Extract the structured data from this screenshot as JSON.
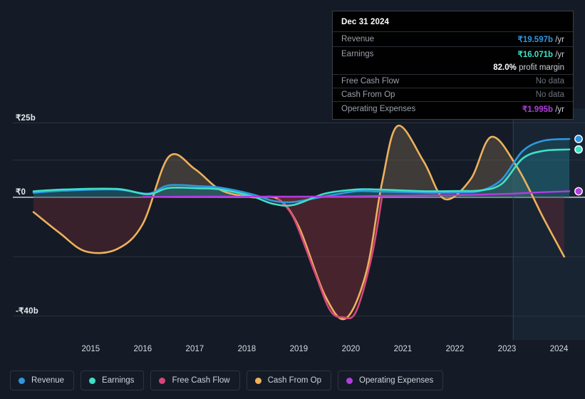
{
  "chart_data": {
    "type": "area",
    "title": "",
    "xlabel": "",
    "ylabel": "",
    "currency_symbol": "₹",
    "y_axis": {
      "ticks": [
        "₹25b",
        "₹0",
        "-₹40b"
      ],
      "tick_values": [
        25,
        0,
        -40
      ],
      "ylim": [
        -48,
        28
      ],
      "unit": "billions INR"
    },
    "x_axis": {
      "ticks": [
        "2015",
        "2016",
        "2017",
        "2018",
        "2019",
        "2020",
        "2021",
        "2022",
        "2023",
        "2024"
      ],
      "xlim": [
        2014.4,
        2025.0
      ]
    },
    "grid": true,
    "legend_position": "bottom",
    "series": [
      {
        "name": "Revenue",
        "color": "#2e97e0",
        "x": [
          2014.4,
          2015,
          2016,
          2016.6,
          2017,
          2017.6,
          2018,
          2018.6,
          2019,
          2019.4,
          2020,
          2020.6,
          2021,
          2021.6,
          2022,
          2022.6,
          2023,
          2023.4,
          2023.8,
          2024.2,
          2024.7
        ],
        "values": [
          1.5,
          2.2,
          2.6,
          1.2,
          4.0,
          3.7,
          3.2,
          1.0,
          -1.2,
          -1.6,
          0.3,
          2.0,
          1.9,
          1.7,
          1.5,
          1.6,
          2.2,
          6.0,
          15.5,
          19.0,
          19.597
        ]
      },
      {
        "name": "Earnings",
        "color": "#3fe0c8",
        "x": [
          2014.4,
          2015,
          2016,
          2016.6,
          2017,
          2017.6,
          2018,
          2018.6,
          2019,
          2019.4,
          2020,
          2020.6,
          2021,
          2021.6,
          2022,
          2022.6,
          2023,
          2023.4,
          2023.8,
          2024.2,
          2024.7
        ],
        "values": [
          2.0,
          2.6,
          2.8,
          1.0,
          3.1,
          3.0,
          2.6,
          0.3,
          -2.2,
          -2.6,
          1.2,
          2.6,
          2.6,
          2.2,
          2.0,
          2.1,
          2.3,
          4.5,
          13.0,
          15.6,
          16.071
        ]
      },
      {
        "name": "Free Cash Flow",
        "color": "#d4467a",
        "x": [
          2019.1,
          2019.4,
          2019.8,
          2020.1,
          2020.35,
          2020.6,
          2020.9,
          2021.1
        ],
        "values": [
          -0.5,
          -7.0,
          -25.0,
          -38.0,
          -40.4,
          -38.5,
          -20.0,
          0.2
        ]
      },
      {
        "name": "Cash From Op",
        "color": "#eeb15c",
        "x": [
          2014.4,
          2014.9,
          2015.4,
          2016.0,
          2016.5,
          2017.0,
          2017.5,
          2018.0,
          2018.6,
          2019.1,
          2019.5,
          2020.0,
          2020.4,
          2020.8,
          2021.1,
          2021.4,
          2021.9,
          2022.3,
          2022.8,
          2023.2,
          2023.7,
          2024.2,
          2024.6
        ],
        "values": [
          -5.0,
          -12.0,
          -18.2,
          -17.5,
          -9.0,
          13.6,
          9.5,
          2.4,
          0.0,
          -0.6,
          -10.0,
          -33.0,
          -40.8,
          -25.0,
          5.0,
          24.0,
          12.0,
          -0.6,
          6.0,
          20.3,
          10.0,
          -7.0,
          -20.0
        ]
      },
      {
        "name": "Operating Expenses",
        "color": "#b23ce0",
        "x": [
          2016.5,
          2017,
          2018,
          2019,
          2020,
          2020.6,
          2021,
          2021.6,
          2022,
          2022.6,
          2023,
          2023.6,
          2024.2,
          2024.7
        ],
        "values": [
          0.1,
          0.15,
          0.2,
          0.2,
          0.2,
          0.3,
          0.4,
          0.5,
          0.6,
          0.7,
          0.9,
          1.2,
          1.7,
          1.995
        ]
      }
    ],
    "end_markers": [
      {
        "series": "Revenue",
        "value": 19.597,
        "color": "#2e97e0"
      },
      {
        "series": "Earnings",
        "value": 16.071,
        "color": "#3fe0c8"
      },
      {
        "series": "Operating Expenses",
        "value": 1.995,
        "color": "#b23ce0"
      }
    ]
  },
  "tooltip": {
    "date": "Dec 31 2024",
    "rows": [
      {
        "key": "Revenue",
        "amount": "₹19.597b",
        "unit": "/yr",
        "color": "#2e97e0",
        "nodata": false
      },
      {
        "key": "Earnings",
        "amount": "₹16.071b",
        "unit": "/yr",
        "color": "#3fe0c8",
        "nodata": false
      },
      {
        "key": "",
        "margin_pct": "82.0%",
        "margin_text": "profit margin"
      },
      {
        "key": "Free Cash Flow",
        "nodata_text": "No data",
        "nodata": true
      },
      {
        "key": "Cash From Op",
        "nodata_text": "No data",
        "nodata": true
      },
      {
        "key": "Operating Expenses",
        "amount": "₹1.995b",
        "unit": "/yr",
        "color": "#b23ce0",
        "nodata": false
      }
    ]
  },
  "legend": {
    "items": [
      {
        "label": "Revenue",
        "color": "#2e97e0"
      },
      {
        "label": "Earnings",
        "color": "#3fe0c8"
      },
      {
        "label": "Free Cash Flow",
        "color": "#d4467a"
      },
      {
        "label": "Cash From Op",
        "color": "#eeb15c"
      },
      {
        "label": "Operating Expenses",
        "color": "#b23ce0"
      }
    ]
  },
  "theme": {
    "background": "#141b26",
    "grid_color": "#2b3340",
    "zero_line_color": "#b9bfc9",
    "highlight_band": "#1b2c3d"
  }
}
